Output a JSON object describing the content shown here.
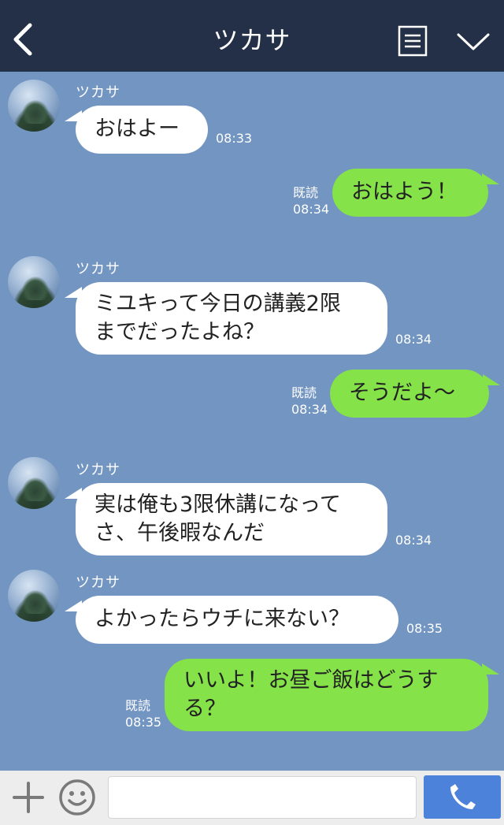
{
  "header": {
    "title": "ツカサ",
    "back_icon": "chevron-left-icon",
    "menu_icon": "notes-icon",
    "collapse_icon": "chevron-down-icon"
  },
  "messages": [
    {
      "side": "in",
      "sender": "ツカサ",
      "text": "おはよー",
      "time": "08:33"
    },
    {
      "side": "out",
      "read": "既読",
      "text": "おはよう！",
      "time": "08:34"
    },
    {
      "side": "in",
      "sender": "ツカサ",
      "lines": [
        "ミユキって今日の講義2限",
        "までだったよね？"
      ],
      "time": "08:34"
    },
    {
      "side": "out",
      "read": "既読",
      "text": "そうだよ〜",
      "time": "08:34"
    },
    {
      "side": "in",
      "sender": "ツカサ",
      "lines": [
        "実は俺も3限休講になって",
        "さ、午後暇なんだ"
      ],
      "time": "08:34"
    },
    {
      "side": "in",
      "sender": "ツカサ",
      "text": "よかったらウチに来ない？",
      "time": "08:35"
    },
    {
      "side": "out",
      "read": "既読",
      "lines": [
        "いいよ！お昼ご飯はどうす",
        "る？"
      ],
      "time": "08:35"
    }
  ],
  "input": {
    "placeholder": "",
    "add_icon": "plus-icon",
    "emoji_icon": "smiley-icon",
    "call_icon": "phone-icon"
  },
  "colors": {
    "background": "#7395c2",
    "header": "#243047",
    "outgoing_bubble": "#85e249",
    "incoming_bubble": "#ffffff",
    "send_button": "#4c82da"
  }
}
